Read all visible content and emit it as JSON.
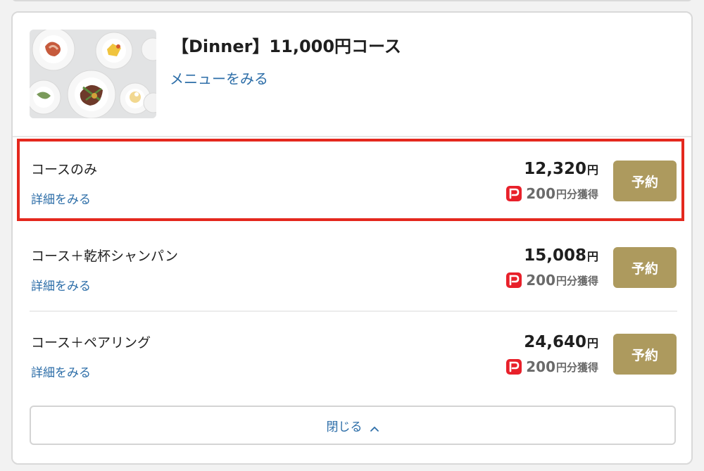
{
  "course": {
    "title": "【Dinner】11,000円コース",
    "menu_link": "メニューをみる"
  },
  "plans": [
    {
      "name": "コースのみ",
      "details_link": "詳細をみる",
      "price": "12,320",
      "currency": "円",
      "points": "200",
      "points_suffix": "円分獲得",
      "reserve_label": "予約",
      "highlighted": true
    },
    {
      "name": "コース＋乾杯シャンパン",
      "details_link": "詳細をみる",
      "price": "15,008",
      "currency": "円",
      "points": "200",
      "points_suffix": "円分獲得",
      "reserve_label": "予約",
      "highlighted": false
    },
    {
      "name": "コース＋ペアリング",
      "details_link": "詳細をみる",
      "price": "24,640",
      "currency": "円",
      "points": "200",
      "points_suffix": "円分獲得",
      "reserve_label": "予約",
      "highlighted": false
    }
  ],
  "close_button": {
    "label": "閉じる"
  },
  "icons": {
    "points_logo": "paypay-icon",
    "close_chevron": "chevron-up-icon",
    "course_image": "dinner-course-photo"
  },
  "colors": {
    "link": "#2d6ea8",
    "reserve_button": "#ad9a5e",
    "highlight_border": "#e4281e",
    "points_logo": "#e8202a"
  }
}
